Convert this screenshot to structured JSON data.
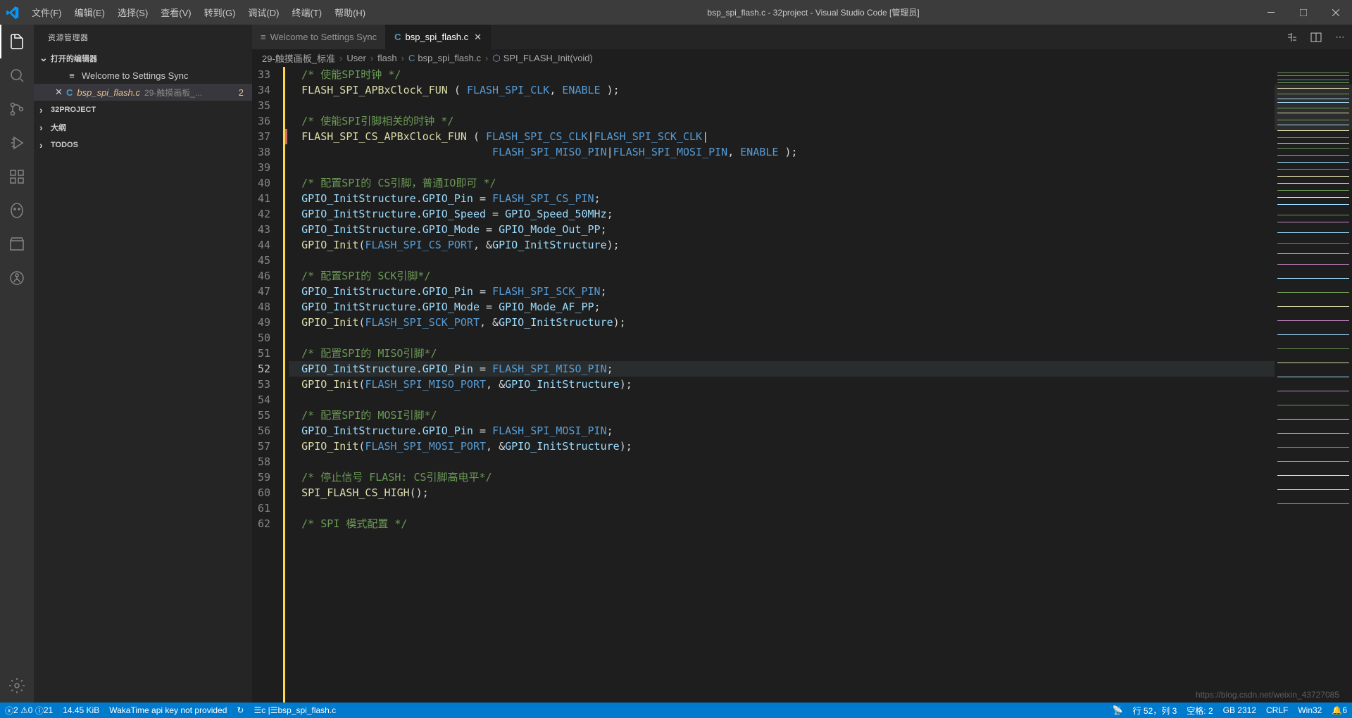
{
  "title": "bsp_spi_flash.c - 32project - Visual Studio Code [管理员]",
  "menu": [
    "文件(F)",
    "编辑(E)",
    "选择(S)",
    "查看(V)",
    "转到(G)",
    "调试(D)",
    "终端(T)",
    "帮助(H)"
  ],
  "sidebar": {
    "header": "资源管理器",
    "open_editors": "打开的编辑器",
    "file1": "Welcome to Settings Sync",
    "file2_name": "bsp_spi_flash.c",
    "file2_desc": "29-触摸画板_...",
    "file2_badge": "2",
    "project": "32PROJECT",
    "outline": "大纲",
    "todos": "TODOS"
  },
  "tabs": {
    "tab1": "Welcome to Settings Sync",
    "tab2": "bsp_spi_flash.c"
  },
  "breadcrumb": {
    "p1": "29-触摸画板_标准",
    "p2": "User",
    "p3": "flash",
    "p4": "bsp_spi_flash.c",
    "p5": "SPI_FLASH_Init(void)"
  },
  "line_numbers": [
    "33",
    "34",
    "35",
    "36",
    "37",
    "38",
    "39",
    "40",
    "41",
    "42",
    "43",
    "44",
    "45",
    "46",
    "47",
    "48",
    "49",
    "50",
    "51",
    "52",
    "53",
    "54",
    "55",
    "56",
    "57",
    "58",
    "59",
    "60",
    "61",
    "62"
  ],
  "code": {
    "l33": "/* 使能SPI时钟 */",
    "l34_fn": "FLASH_SPI_APBxClock_FUN",
    "l34_a1": "FLASH_SPI_CLK",
    "l34_a2": "ENABLE",
    "l36": "/* 使能SPI引脚相关的时钟 */",
    "l37_fn": "FLASH_SPI_CS_APBxClock_FUN",
    "l37_a1": "FLASH_SPI_CS_CLK",
    "l37_a2": "FLASH_SPI_SCK_CLK",
    "l38_a1": "FLASH_SPI_MISO_PIN",
    "l38_a2": "FLASH_SPI_MOSI_PIN",
    "l38_a3": "ENABLE",
    "l40": "/* 配置SPI的 CS引脚，普通IO即可 */",
    "l41_var": "GPIO_InitStructure",
    "l41_mem": "GPIO_Pin",
    "l41_val": "FLASH_SPI_CS_PIN",
    "l42_mem": "GPIO_Speed",
    "l42_val": "GPIO_Speed_50MHz",
    "l43_mem": "GPIO_Mode",
    "l43_val": "GPIO_Mode_Out_PP",
    "l44_fn": "GPIO_Init",
    "l44_a1": "FLASH_SPI_CS_PORT",
    "l44_a2": "GPIO_InitStructure",
    "l46": "/* 配置SPI的 SCK引脚*/",
    "l47_val": "FLASH_SPI_SCK_PIN",
    "l48_val": "GPIO_Mode_AF_PP",
    "l49_a1": "FLASH_SPI_SCK_PORT",
    "l51": "/* 配置SPI的 MISO引脚*/",
    "l52_val": "FLASH_SPI_MISO_PIN",
    "l53_a1": "FLASH_SPI_MISO_PORT",
    "l55": "/* 配置SPI的 MOSI引脚*/",
    "l56_val": "FLASH_SPI_MOSI_PIN",
    "l57_a1": "FLASH_SPI_MOSI_PORT",
    "l59": "/* 停止信号 FLASH: CS引脚高电平*/",
    "l60_fn": "SPI_FLASH_CS_HIGH",
    "l62": "/* SPI 模式配置 */"
  },
  "status": {
    "errors": "2",
    "warnings": "0",
    "info": "21",
    "size": "14.45 KiB",
    "waka": "WakaTime api key not provided",
    "c_file": "c |",
    "c_path": "bsp_spi_flash.c",
    "line_col": "行 52，列 3",
    "spaces": "空格: 2",
    "encoding": "GB 2312",
    "eol": "CRLF",
    "os": "Win32",
    "bell": "6"
  },
  "watermark": "https://blog.csdn.net/weixin_43727085"
}
